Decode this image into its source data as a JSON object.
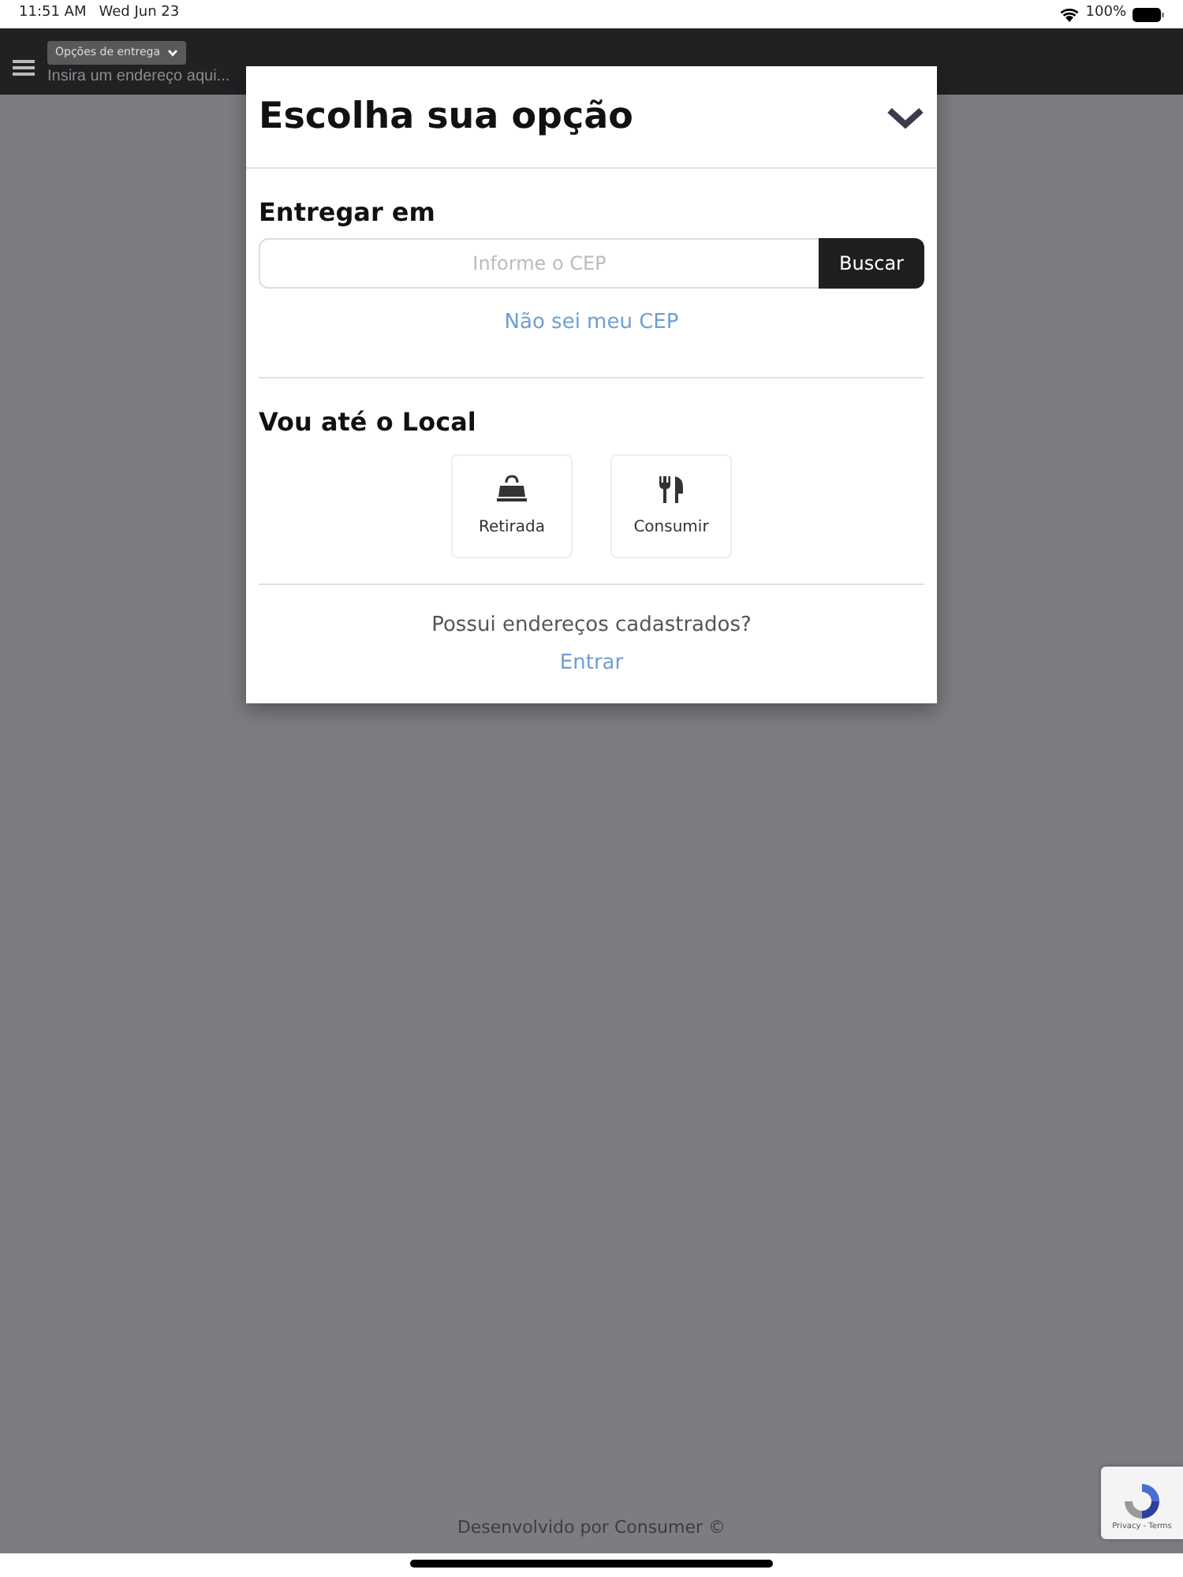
{
  "status_bar": {
    "time": "11:51 AM",
    "date": "Wed Jun 23",
    "battery": "100%"
  },
  "navbar": {
    "delivery_button": "Opções de entrega",
    "address": "Insira um endereço aqui..."
  },
  "modal": {
    "title": "Escolha sua opção",
    "deliver": {
      "heading": "Entregar em",
      "placeholder": "Informe o CEP",
      "button": "Buscar",
      "link": "Não sei meu CEP"
    },
    "visit": {
      "heading": "Vou até o Local",
      "options": [
        {
          "label": "Retirada",
          "kind": "bag"
        },
        {
          "label": "Consumir",
          "kind": "cutlery"
        }
      ]
    },
    "login": {
      "question": "Possui endereços cadastrados?",
      "link": "Entrar"
    }
  },
  "footer": "Desenvolvido por Consumer ©",
  "recaptcha": "Privacy - Terms"
}
